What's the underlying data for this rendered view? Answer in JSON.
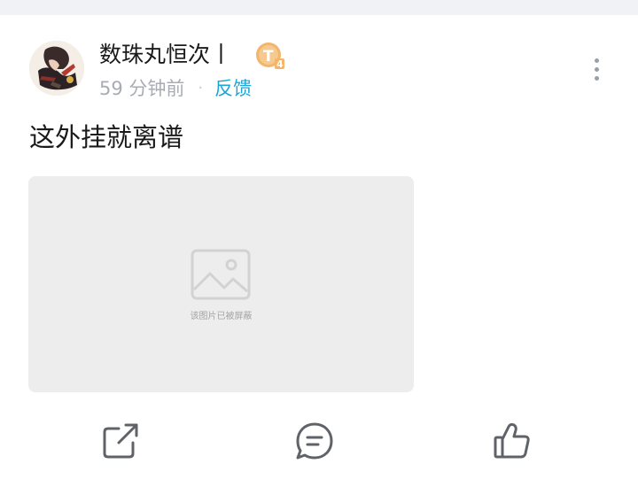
{
  "post": {
    "author": {
      "name": "数珠丸恒次丨",
      "level_badge": "T4"
    },
    "time": "59 分钟前",
    "separator": "·",
    "feedback_label": "反馈",
    "text": "这外挂就离谱",
    "image": {
      "caption": "该图片已被屏蔽",
      "icon": "image-placeholder-icon"
    }
  },
  "actions": {
    "share_icon": "share-icon",
    "comment_icon": "comment-icon",
    "like_icon": "thumbs-up-icon"
  },
  "colors": {
    "link": "#1aa6d6",
    "muted": "#a9acb2",
    "badge": "#f2b56b",
    "placeholder_bg": "#ededed"
  }
}
